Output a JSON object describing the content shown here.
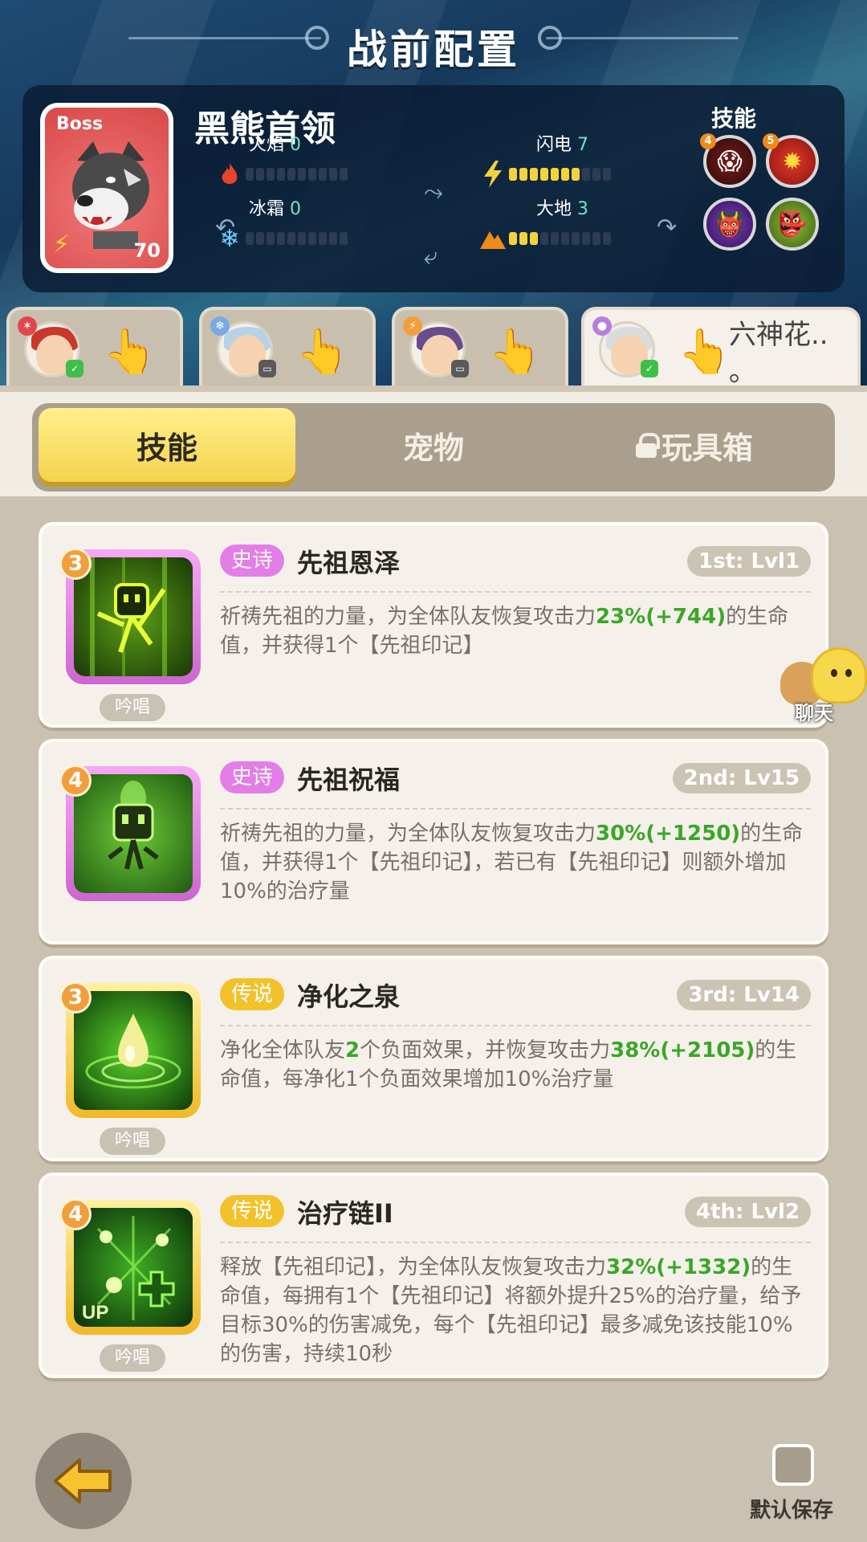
{
  "title": "战前配置",
  "boss": {
    "tag": "Boss",
    "name": "黑熊首领",
    "level": "70",
    "elements": [
      {
        "name": "火焰",
        "value": "0",
        "filled": 0,
        "icon": "flame-icon",
        "color": "#e5462b"
      },
      {
        "name": "闪电",
        "value": "7",
        "filled": 7,
        "icon": "lightning-icon",
        "color": "#f4d23e"
      },
      {
        "name": "冰霜",
        "value": "0",
        "filled": 0,
        "icon": "snowflake-icon",
        "color": "#6fd2ff"
      },
      {
        "name": "大地",
        "value": "3",
        "filled": 3,
        "icon": "earth-icon",
        "color": "#f08a18"
      }
    ],
    "skills_label": "技能",
    "skills": [
      {
        "icon": "wolf-roar-skill-icon",
        "badge": "4"
      },
      {
        "icon": "red-claw-skill-icon",
        "badge": "5"
      },
      {
        "icon": "purple-beast-skill-icon",
        "badge": ""
      },
      {
        "icon": "gold-beast-skill-icon",
        "badge": ""
      }
    ]
  },
  "heroes": [
    {
      "name": "",
      "element_color": "#e2464c",
      "hair": "#c9372d",
      "status": "green"
    },
    {
      "name": "",
      "element_color": "#7aa9e4",
      "hair": "#b7d1e8",
      "status": "gray"
    },
    {
      "name": "",
      "element_color": "#f29e3a",
      "hair": "#6a4b8c",
      "status": "gray"
    },
    {
      "name": "六神花..\n。",
      "element_color": "#b77ee0",
      "hair": "#d9dcdf",
      "status": "green"
    }
  ],
  "tabs": {
    "skill": "技能",
    "pet": "宠物",
    "toybox": "玩具箱"
  },
  "skills": [
    {
      "slot": "3",
      "rarity": "史诗",
      "rarity_type": "epic",
      "name": "先祖恩泽",
      "rank": "1st: Lvl1",
      "desc_parts": [
        "祈祷先祖的力量，为全体队友恢复攻击力",
        "23%(+744)",
        "的生命值，并获得1个【先祖印记】"
      ],
      "tag": "吟唱"
    },
    {
      "slot": "4",
      "rarity": "史诗",
      "rarity_type": "epic",
      "name": "先祖祝福",
      "rank": "2nd: Lv15",
      "desc_parts": [
        "祈祷先祖的力量，为全体队友恢复攻击力",
        "30%(+1250)",
        "的生命值，并获得1个【先祖印记】，若已有【先祖印记】则额外增加10%的治疗量"
      ],
      "tag": ""
    },
    {
      "slot": "3",
      "rarity": "传说",
      "rarity_type": "legend",
      "name": "净化之泉",
      "rank": "3rd: Lv14",
      "desc_parts": [
        "净化全体队友",
        "2",
        "个负面效果，并恢复攻击力",
        "38%(+2105)",
        "的生命值，每净化1个负面效果增加10%治疗量"
      ],
      "tag": "吟唱"
    },
    {
      "slot": "4",
      "rarity": "传说",
      "rarity_type": "legend",
      "name": "治疗链II",
      "rank": "4th: Lvl2",
      "desc_parts": [
        "释放【先祖印记】，为全体队友恢复攻击力",
        "32%(+1332)",
        "的生命值，每拥有1个【先祖印记】将额外提升25%的治疗量，给予目标30%的伤害减免，每个【先祖印记】最多减免该技能10%的伤害，持续10秒"
      ],
      "tag": "吟唱"
    }
  ],
  "chat_label": "聊天",
  "default_save_label": "默认保存"
}
